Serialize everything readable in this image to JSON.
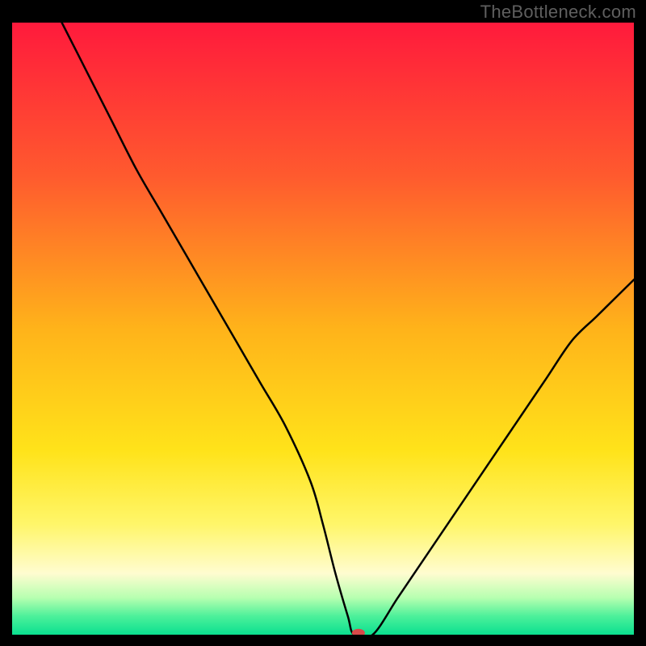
{
  "watermark": "TheBottleneck.com",
  "chart_data": {
    "type": "line",
    "title": "",
    "xlabel": "",
    "ylabel": "",
    "xlim": [
      0,
      100
    ],
    "ylim": [
      0,
      100
    ],
    "legend": false,
    "grid": false,
    "background_gradient": {
      "stops": [
        {
          "offset": 0.0,
          "color": "#ff1a3c"
        },
        {
          "offset": 0.25,
          "color": "#ff5a2e"
        },
        {
          "offset": 0.5,
          "color": "#ffb31a"
        },
        {
          "offset": 0.7,
          "color": "#ffe31a"
        },
        {
          "offset": 0.82,
          "color": "#fff66a"
        },
        {
          "offset": 0.9,
          "color": "#fffcd0"
        },
        {
          "offset": 0.94,
          "color": "#b6ffb0"
        },
        {
          "offset": 0.97,
          "color": "#4cf09a"
        },
        {
          "offset": 1.0,
          "color": "#0ae090"
        }
      ]
    },
    "series": [
      {
        "name": "bottleneck-curve",
        "color": "#000000",
        "x": [
          8,
          12,
          16,
          20,
          24,
          28,
          32,
          36,
          40,
          44,
          48,
          50,
          52,
          54,
          55,
          58,
          62,
          66,
          70,
          74,
          78,
          82,
          86,
          90,
          94,
          98,
          100
        ],
        "y": [
          100,
          92,
          84,
          76,
          69,
          62,
          55,
          48,
          41,
          34,
          25,
          18,
          10,
          3,
          0,
          0,
          6,
          12,
          18,
          24,
          30,
          36,
          42,
          48,
          52,
          56,
          58
        ]
      }
    ],
    "marker": {
      "x": 55.7,
      "y": 0.3,
      "color": "#d74a4a",
      "rx": 8,
      "ry": 5
    }
  }
}
